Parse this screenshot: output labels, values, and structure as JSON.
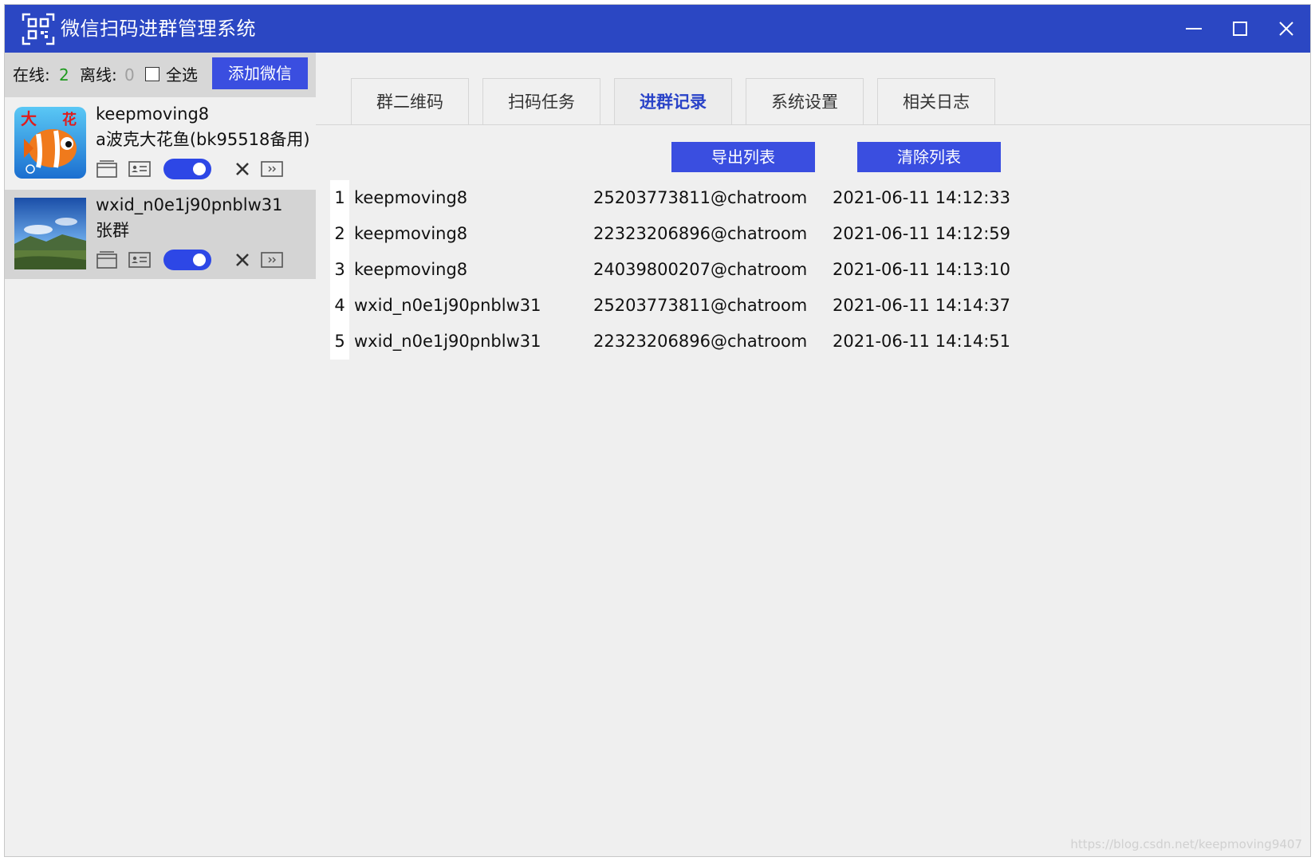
{
  "window": {
    "title": "微信扫码进群管理系统"
  },
  "sidebar": {
    "online_label": "在线:",
    "online_count": "2",
    "offline_label": "离线:",
    "offline_count": "0",
    "select_all_label": "全选",
    "add_button": "添加微信",
    "accounts": [
      {
        "wxid": "keepmoving8",
        "nickname": "a波克大花鱼(bk95518备用)",
        "avatar_icon": "clownfish-game-avatar"
      },
      {
        "wxid": "wxid_n0e1j90pnblw31",
        "nickname": "张群",
        "avatar_icon": "landscape-avatar"
      }
    ]
  },
  "tabs": [
    {
      "label": "群二维码"
    },
    {
      "label": "扫码任务"
    },
    {
      "label": "进群记录"
    },
    {
      "label": "系统设置"
    },
    {
      "label": "相关日志"
    }
  ],
  "actions": {
    "export": "导出列表",
    "clear": "清除列表"
  },
  "records": [
    {
      "index": "1",
      "wxid": "keepmoving8",
      "chatroom": "25203773811@chatroom",
      "time": "2021-06-11 14:12:33"
    },
    {
      "index": "2",
      "wxid": "keepmoving8",
      "chatroom": "22323206896@chatroom",
      "time": "2021-06-11 14:12:59"
    },
    {
      "index": "3",
      "wxid": "keepmoving8",
      "chatroom": "24039800207@chatroom",
      "time": "2021-06-11 14:13:10"
    },
    {
      "index": "4",
      "wxid": "wxid_n0e1j90pnblw31",
      "chatroom": "25203773811@chatroom",
      "time": "2021-06-11 14:14:37"
    },
    {
      "index": "5",
      "wxid": "wxid_n0e1j90pnblw31",
      "chatroom": "22323206896@chatroom",
      "time": "2021-06-11 14:14:51"
    }
  ],
  "watermark": "https://blog.csdn.net/keepmoving9407",
  "colors": {
    "titlebar": "#2b47c3",
    "button": "#3a4ee0",
    "online": "#1f9a1f",
    "active_tab": "#2a43c8"
  }
}
